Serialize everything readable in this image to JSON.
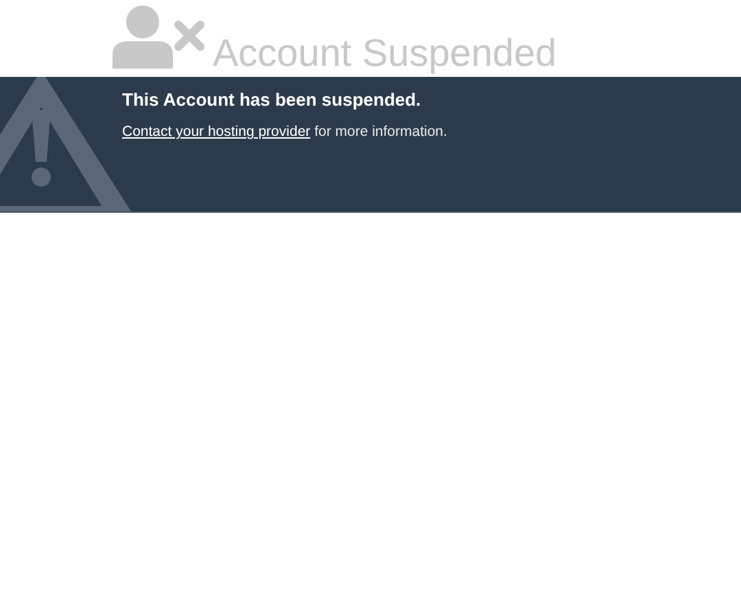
{
  "header": {
    "title": "Account Suspended"
  },
  "notice": {
    "heading": "This Account has been suspended.",
    "link": "Contact your hosting provider",
    "text": " for more information."
  }
}
